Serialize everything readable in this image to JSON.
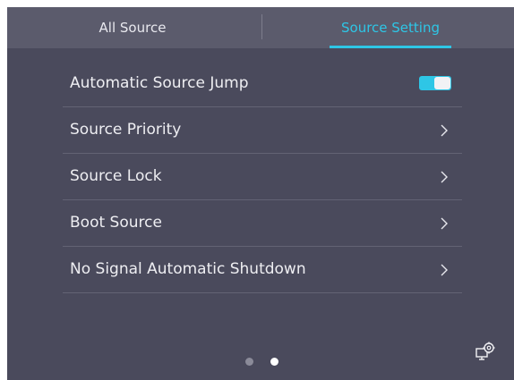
{
  "tabs": {
    "all_source": "All Source",
    "source_setting": "Source Setting",
    "active": "Source Setting"
  },
  "menu": {
    "automatic_source_jump": {
      "label": "Automatic Source Jump",
      "toggle_on": true
    },
    "source_priority": {
      "label": "Source Priority"
    },
    "source_lock": {
      "label": "Source Lock"
    },
    "boot_source": {
      "label": "Boot Source"
    },
    "no_signal_shutdown": {
      "label": "No Signal Automatic Shutdown"
    }
  },
  "pager": {
    "current_page": 2,
    "total_pages": 2
  },
  "icons": {
    "chevron": "chevron-right-icon",
    "settings": "display-settings-icon"
  },
  "colors": {
    "accent": "#2ec6e6",
    "panel_bg": "#4a4a5c",
    "tabbar_bg": "#5b5b6c",
    "text": "#eeeef2"
  }
}
